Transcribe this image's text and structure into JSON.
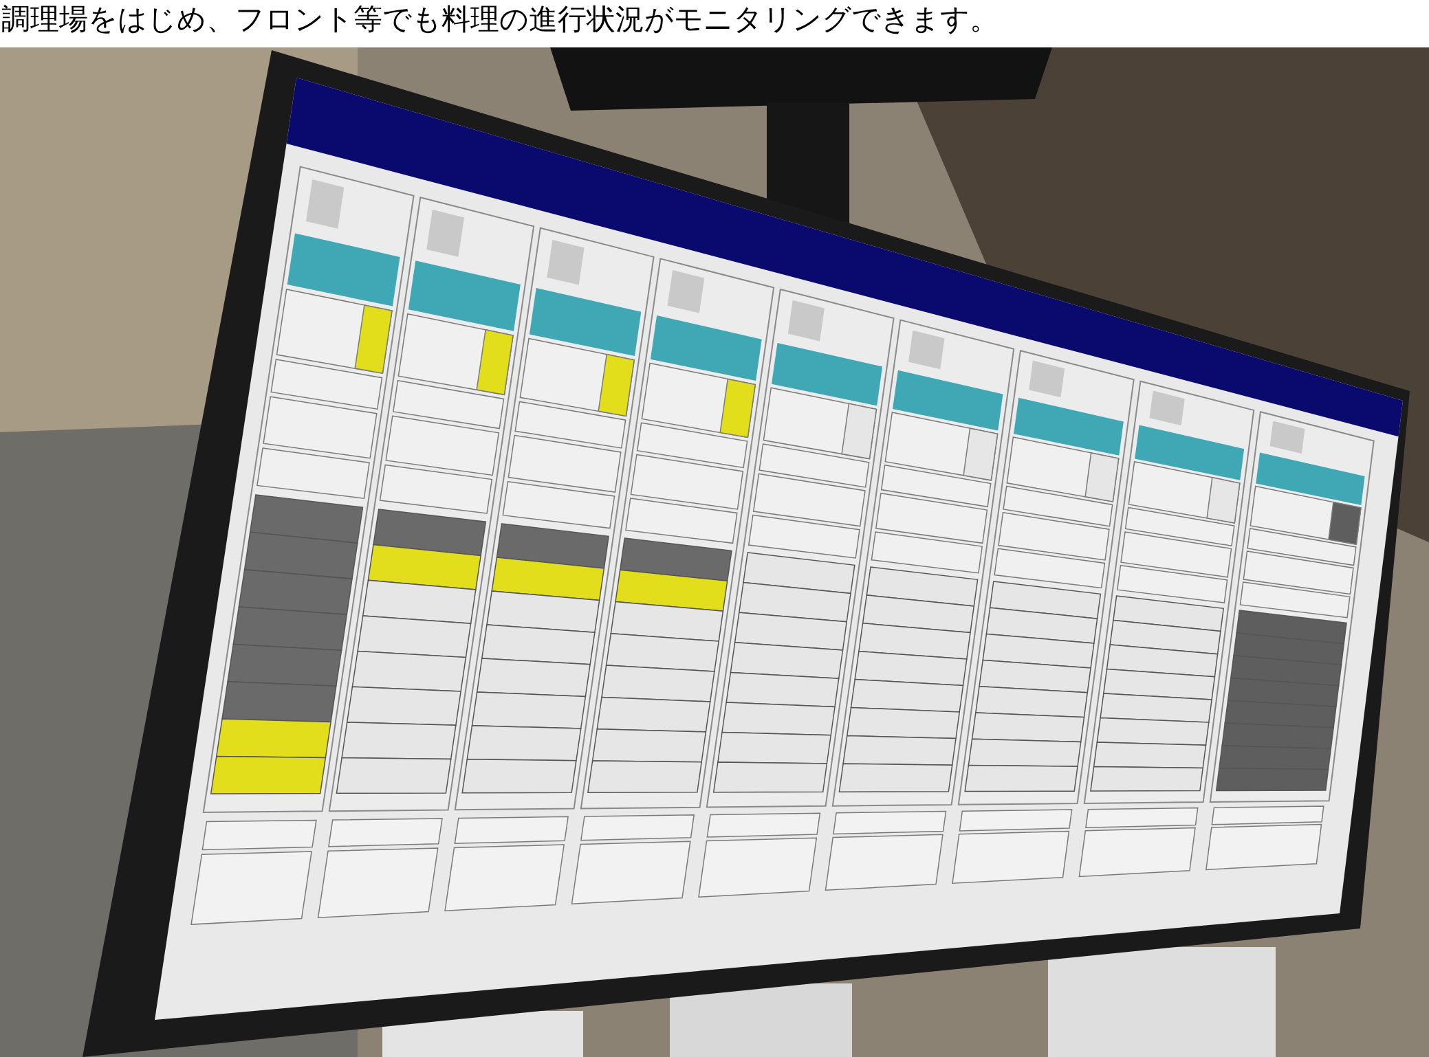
{
  "caption": "調理場をはじめ、フロント等でも料理の進行状況がモニタリングできます。"
}
